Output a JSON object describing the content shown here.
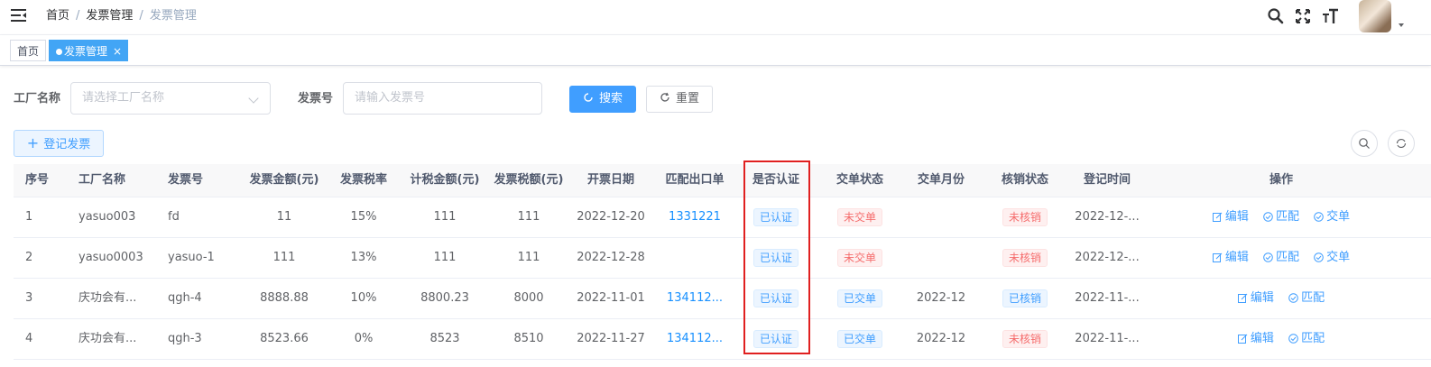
{
  "header": {
    "breadcrumb": [
      "首页",
      "发票管理",
      "发票管理"
    ],
    "sep": "/"
  },
  "tags": [
    {
      "label": "首页"
    },
    {
      "label": "发票管理"
    }
  ],
  "filters": {
    "factory_label": "工厂名称",
    "factory_placeholder": "请选择工厂名称",
    "invoice_label": "发票号",
    "invoice_placeholder": "请输入发票号",
    "search_btn": "搜索",
    "reset_btn": "重置",
    "add_btn": "登记发票"
  },
  "table": {
    "columns": [
      "序号",
      "工厂名称",
      "发票号",
      "发票金额(元)",
      "发票税率",
      "计税金额(元)",
      "发票税额(元)",
      "开票日期",
      "匹配出口单",
      "是否认证",
      "交单状态",
      "交单月份",
      "核销状态",
      "登记时间",
      "操作"
    ],
    "rows": [
      {
        "idx": "1",
        "factory": "yasuo003",
        "invoice": "fd",
        "amount": "11",
        "rate": "15%",
        "taxable": "111",
        "tax": "111",
        "date": "2022-12-20",
        "match": "1331221",
        "cert": "已认证",
        "submit": "未交单",
        "month": "",
        "verify": "未核销",
        "reg": "2022-12-...",
        "actions": [
          "编辑",
          "匹配",
          "交单"
        ]
      },
      {
        "idx": "2",
        "factory": "yasuo0003",
        "invoice": "yasuo-1",
        "amount": "111",
        "rate": "13%",
        "taxable": "111",
        "tax": "111",
        "date": "2022-12-28",
        "match": "",
        "cert": "已认证",
        "submit": "未交单",
        "month": "",
        "verify": "未核销",
        "reg": "2022-12-...",
        "actions": [
          "编辑",
          "匹配",
          "交单"
        ]
      },
      {
        "idx": "3",
        "factory": "庆功会有...",
        "invoice": "qgh-4",
        "amount": "8888.88",
        "rate": "10%",
        "taxable": "8800.23",
        "tax": "8000",
        "date": "2022-11-01",
        "match": "134112...",
        "cert": "已认证",
        "submit": "已交单",
        "month": "2022-12",
        "verify": "已核销",
        "reg": "2022-11-...",
        "actions": [
          "编辑",
          "匹配"
        ]
      },
      {
        "idx": "4",
        "factory": "庆功会有...",
        "invoice": "qgh-3",
        "amount": "8523.66",
        "rate": "0%",
        "taxable": "8523",
        "tax": "8510",
        "date": "2022-11-27",
        "match": "134112...",
        "cert": "已认证",
        "submit": "已交单",
        "month": "2022-12",
        "verify": "未核销",
        "reg": "2022-11-...",
        "actions": [
          "编辑",
          "匹配"
        ]
      }
    ]
  },
  "colors": {
    "primary": "#409eff",
    "tag_active": "#42a5f5",
    "highlight_box": "#e02020"
  }
}
